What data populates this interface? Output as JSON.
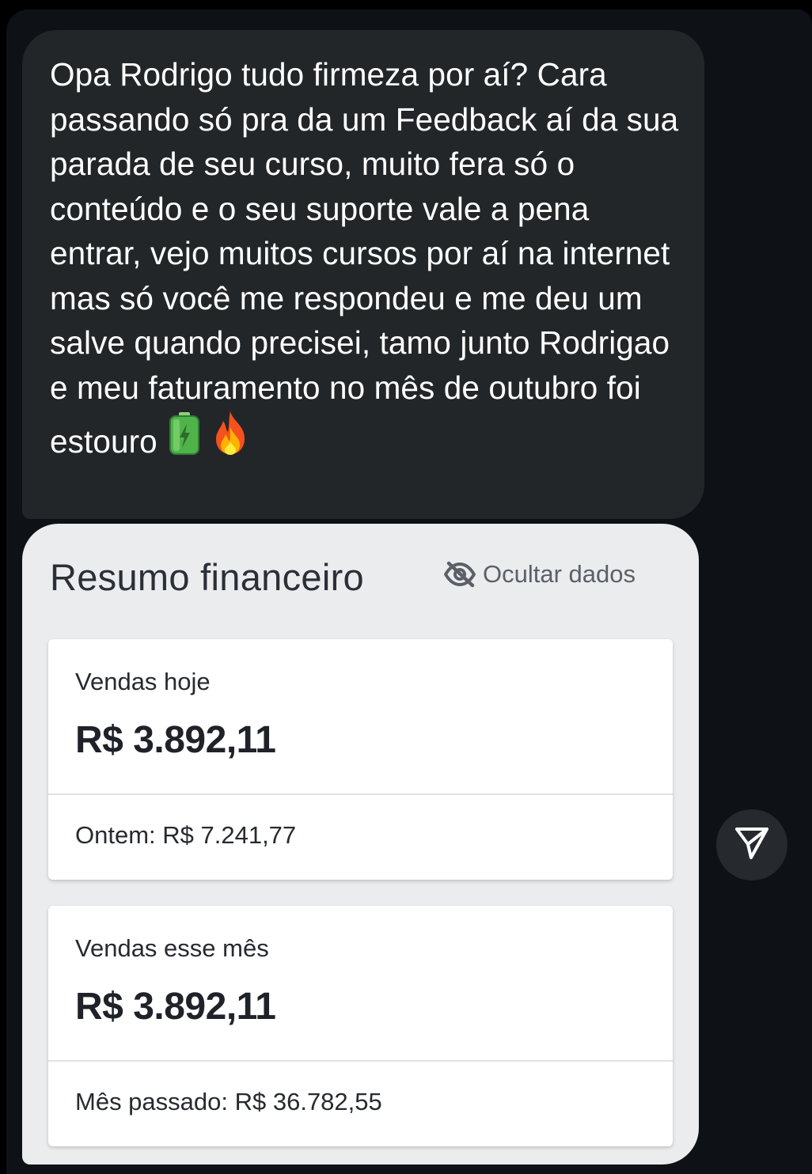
{
  "message": {
    "text": "Opa Rodrigo tudo firmeza por aí? Cara passando só pra da um Feedback aí da sua parada de seu curso, muito fera só o conteúdo e o seu suporte vale a pena entrar, vejo muitos cursos por aí na internet mas só você me respondeu e me deu um salve quando precisei, tamo junto Rodrigao e meu faturamento no mês de outubro foi estouro",
    "emojis": [
      "battery-icon",
      "fire-icon"
    ]
  },
  "summary": {
    "title": "Resumo financeiro",
    "hide_label": "Ocultar dados",
    "today": {
      "label": "Vendas hoje",
      "value": "R$ 3.892,11",
      "compare": "Ontem: R$ 7.241,77"
    },
    "month": {
      "label": "Vendas esse mês",
      "value": "R$ 3.892,11",
      "compare": "Mês passado: R$ 36.782,55"
    }
  },
  "actions": {
    "send_icon": "send-icon"
  },
  "colors": {
    "background": "#000000",
    "chat_background": "#0e1217",
    "message_bubble": "#232629",
    "card_bubble": "#ebecee",
    "send_button": "#262a2e"
  }
}
